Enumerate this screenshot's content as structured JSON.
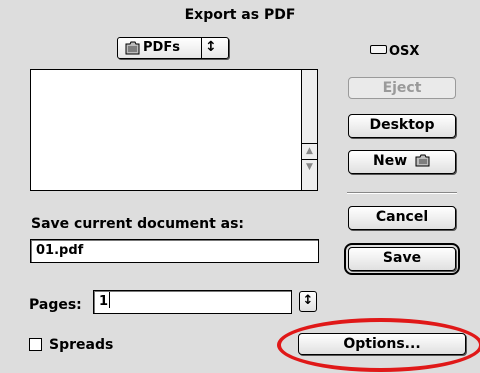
{
  "dialog": {
    "title": "Export as PDF"
  },
  "location": {
    "folder_label": "PDFs",
    "popup_arrow": "↕",
    "drive_label": "OSX",
    "folder_icon": "folder-icon",
    "drive_icon": "hard-drive-icon"
  },
  "buttons": {
    "eject": "Eject",
    "desktop": "Desktop",
    "new": "New",
    "cancel": "Cancel",
    "save": "Save",
    "options": "Options..."
  },
  "save_as": {
    "label": "Save current document as:",
    "value": "01.pdf"
  },
  "pages": {
    "label": "Pages:",
    "value": "1",
    "stepper_arrow": "↕"
  },
  "spreads": {
    "label": "Spreads",
    "checked": false
  },
  "scroll": {
    "up": "▲",
    "down": "▼"
  },
  "annotation": {
    "color": "#e01818"
  }
}
